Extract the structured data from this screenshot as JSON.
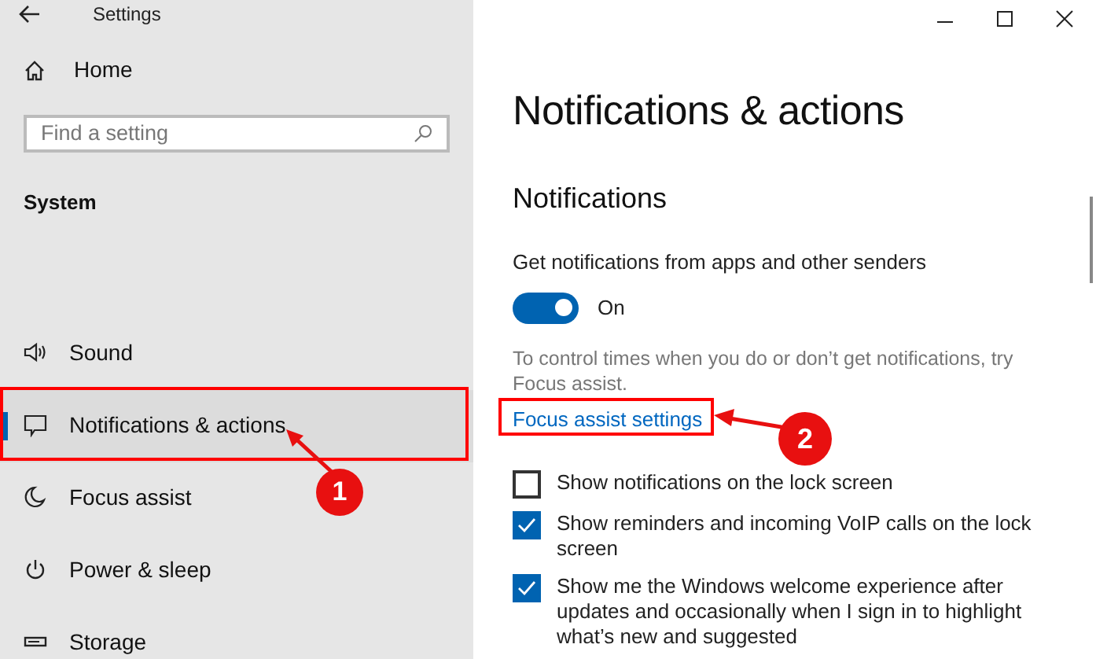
{
  "window": {
    "title": "Settings"
  },
  "sidebar": {
    "home": "Home",
    "search": {
      "placeholder": "Find a setting"
    },
    "section": "System",
    "items": [
      {
        "label": "Sound",
        "selected": false
      },
      {
        "label": "Notifications & actions",
        "selected": true
      },
      {
        "label": "Focus assist",
        "selected": false
      },
      {
        "label": "Power & sleep",
        "selected": false
      },
      {
        "label": "Storage",
        "selected": false
      }
    ]
  },
  "page": {
    "title": "Notifications & actions",
    "section": "Notifications",
    "setting_label": "Get notifications from apps and other senders",
    "toggle": {
      "on": true,
      "label": "On"
    },
    "description": "To control times when you do or don’t get notifications, try Focus assist.",
    "link": "Focus assist settings",
    "checkboxes": [
      {
        "label": "Show notifications on the lock screen",
        "checked": false
      },
      {
        "label": "Show reminders and incoming VoIP calls on the lock screen",
        "checked": true
      },
      {
        "label": "Show me the Windows welcome experience after updates and occasionally when I sign in to highlight what’s new and suggested",
        "checked": true
      }
    ]
  },
  "callouts": [
    {
      "number": "1"
    },
    {
      "number": "2"
    }
  ]
}
